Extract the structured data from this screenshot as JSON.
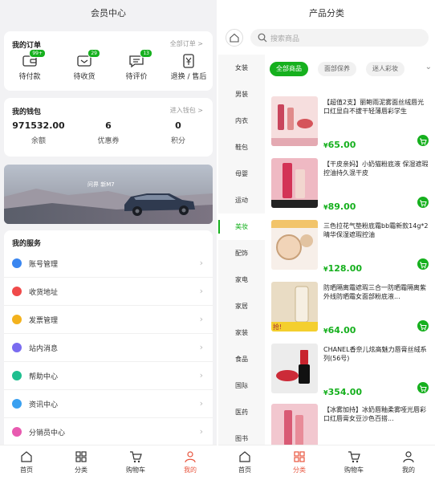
{
  "member": {
    "title": "会员中心",
    "orders": {
      "title": "我的订单",
      "all_link": "全部订单 >",
      "items": [
        {
          "label": "待付款",
          "badge": "99+",
          "icon": "wallet-icon"
        },
        {
          "label": "待收货",
          "badge": "29",
          "icon": "truck-box-icon"
        },
        {
          "label": "待评价",
          "badge": "13",
          "icon": "comment-icon"
        },
        {
          "label": "退换 / 售后",
          "badge": "",
          "icon": "yen-refund-icon"
        }
      ]
    },
    "wallet": {
      "title": "我的钱包",
      "link": "进入钱包 >",
      "items": [
        {
          "value": "971532.00",
          "label": "余额"
        },
        {
          "value": "6",
          "label": "优惠券"
        },
        {
          "value": "0",
          "label": "积分"
        }
      ]
    },
    "banner": {
      "brand": "问界 新M7"
    },
    "services": {
      "title": "我的服务",
      "items": [
        {
          "label": "账号管理",
          "color": "#3a86f0",
          "icon": "user-icon"
        },
        {
          "label": "收货地址",
          "color": "#f04a4a",
          "icon": "location-icon"
        },
        {
          "label": "发票管理",
          "color": "#f3b21d",
          "icon": "invoice-icon"
        },
        {
          "label": "站内消息",
          "color": "#7a6cf0",
          "icon": "message-icon"
        },
        {
          "label": "帮助中心",
          "color": "#1fbf8f",
          "icon": "help-icon"
        },
        {
          "label": "资讯中心",
          "color": "#3aa0f0",
          "icon": "news-icon"
        },
        {
          "label": "分销员中心",
          "color": "#e85ab0",
          "icon": "distributor-icon"
        }
      ]
    },
    "tabbar": [
      {
        "label": "首页",
        "icon": "home-icon",
        "active": false
      },
      {
        "label": "分类",
        "icon": "category-icon",
        "active": false
      },
      {
        "label": "购物车",
        "icon": "cart-icon",
        "active": false
      },
      {
        "label": "我的",
        "icon": "profile-icon",
        "active": true
      }
    ]
  },
  "category": {
    "title": "产品分类",
    "search_placeholder": "搜索商品",
    "sidebar": [
      "女装",
      "男装",
      "内衣",
      "鞋包",
      "母婴",
      "运动",
      "美妆",
      "配饰",
      "家电",
      "家居",
      "家装",
      "食品",
      "国际",
      "医药",
      "图书"
    ],
    "active_sidebar": "美妆",
    "chips": [
      "全部商品",
      "面部保养",
      "迷人彩妆"
    ],
    "active_chip": "全部商品",
    "products": [
      {
        "name": "【超值2支】丽鲍雨泥雾面丝绒唇光口红显白不拔干轻薄唇彩学生",
        "currency": "¥",
        "price": "65.00"
      },
      {
        "name": "【干皮亲妈】小奶猫粉底液 保湿遮瑕控油持久混干皮",
        "currency": "¥",
        "price": "89.00"
      },
      {
        "name": "三色拉花气垫粉底霜bb霜新款14g*2 晴华保湿遮瑕控油",
        "currency": "¥",
        "price": "128.00"
      },
      {
        "name": "防晒隔离霜遮瑕三合一防晒霜隔离紫外线防晒霜女面部粉底液...",
        "currency": "¥",
        "price": "64.00"
      },
      {
        "name": "CHANEL香奈儿炫高魅力唇膏丝绒系列(56号)",
        "currency": "¥",
        "price": "354.00"
      },
      {
        "name": "【冰雾加持】冰奶唇釉柔雾哑光唇彩口红唇膏女豆沙色百搭...",
        "currency": "¥",
        "price": ""
      }
    ],
    "tabbar": [
      {
        "label": "首页",
        "icon": "home-icon",
        "active": false
      },
      {
        "label": "分类",
        "icon": "category-icon",
        "active": true
      },
      {
        "label": "购物车",
        "icon": "cart-icon",
        "active": false
      },
      {
        "label": "我的",
        "icon": "profile-icon",
        "active": false
      }
    ]
  },
  "colors": {
    "accent_green": "#16b01e",
    "accent_red": "#e8553e"
  }
}
